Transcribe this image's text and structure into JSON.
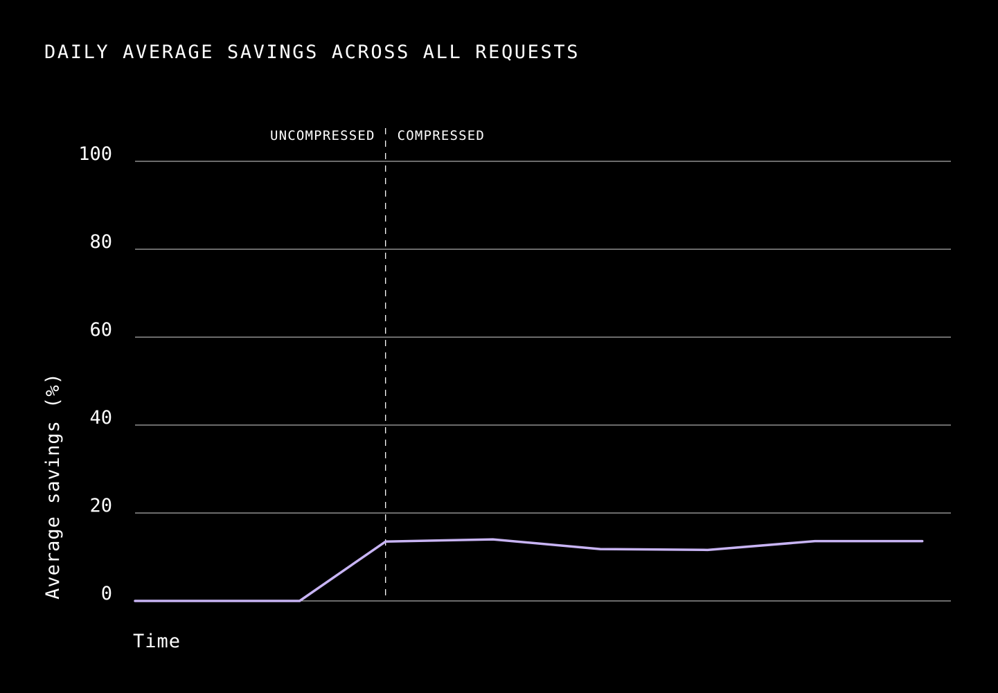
{
  "chart_data": {
    "type": "line",
    "title": "DAILY AVERAGE SAVINGS ACROSS ALL REQUESTS",
    "xlabel": "Time",
    "ylabel": "Average savings (%)",
    "ylim": [
      0,
      100
    ],
    "yticks": [
      "0",
      "20",
      "40",
      "60",
      "80",
      "100"
    ],
    "grid": true,
    "annotations": {
      "divider_x": 3.5,
      "left_label": "UNCOMPRESSED",
      "right_label": "COMPRESSED"
    },
    "series": [
      {
        "x": [
          0,
          2.3,
          3.5,
          5,
          6.5,
          8,
          9.5,
          11
        ],
        "values": [
          0,
          0,
          13.5,
          14,
          11.8,
          11.6,
          13.6,
          13.6
        ]
      }
    ],
    "line_color": "#c8b4f4",
    "grid_color": "#ffffff"
  }
}
